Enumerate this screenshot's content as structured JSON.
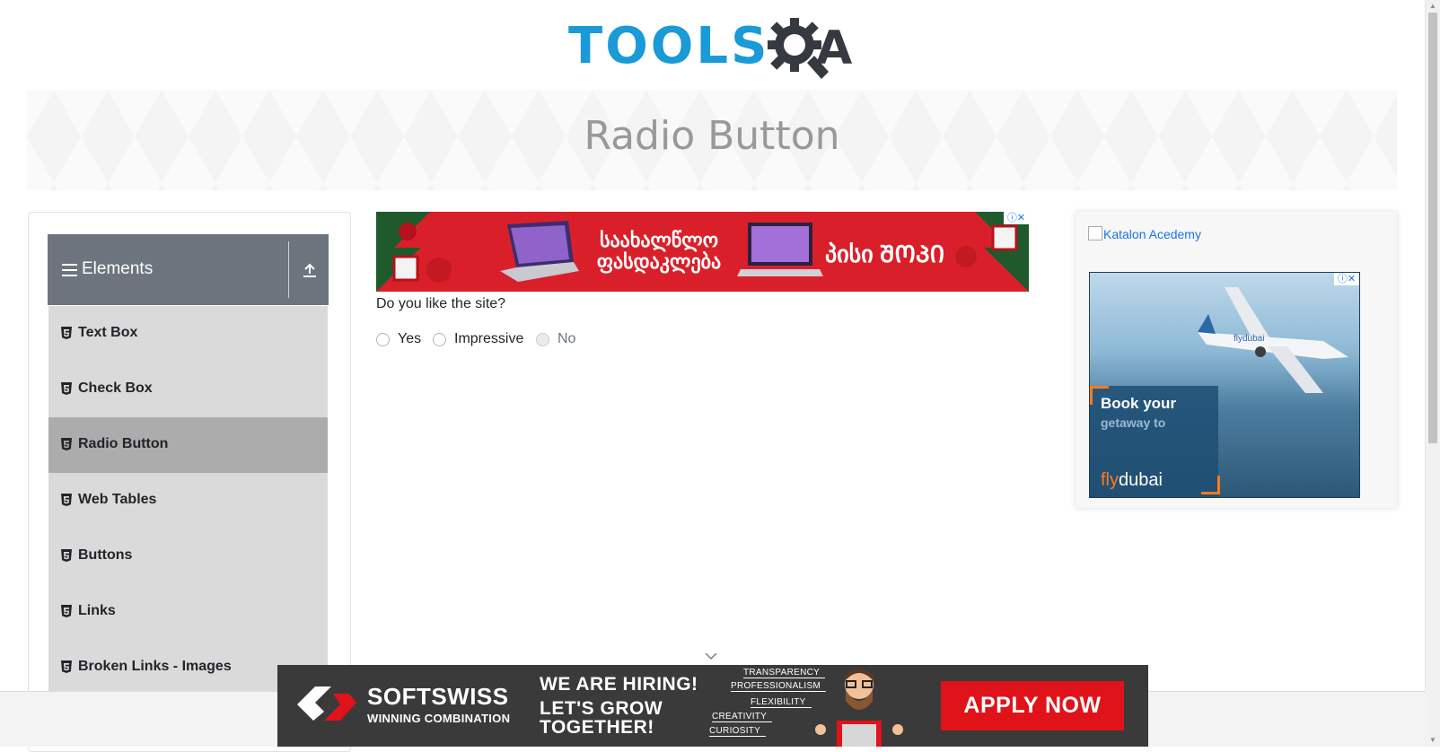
{
  "logo": {
    "text_tools": "TOOLS",
    "text_qa_letter": "A",
    "alt": "ToolsQA"
  },
  "page": {
    "title": "Radio Button"
  },
  "sidebar": {
    "group_title": "Elements",
    "items": [
      {
        "label": "Text Box",
        "active": false
      },
      {
        "label": "Check Box",
        "active": false
      },
      {
        "label": "Radio Button",
        "active": true
      },
      {
        "label": "Web Tables",
        "active": false
      },
      {
        "label": "Buttons",
        "active": false
      },
      {
        "label": "Links",
        "active": false
      },
      {
        "label": "Broken Links - Images",
        "active": false
      }
    ]
  },
  "main": {
    "question": "Do you like the site?",
    "options": [
      {
        "label": "Yes",
        "disabled": false,
        "checked": false
      },
      {
        "label": "Impressive",
        "disabled": false,
        "checked": false
      },
      {
        "label": "No",
        "disabled": true,
        "checked": false
      }
    ]
  },
  "center_ad": {
    "line1": "საახალწლო",
    "line2": "ფასდაკლება",
    "right_text": "პისი ᲨᲝᲞᲘ"
  },
  "right_ad": {
    "broken_image_alt": "Katalon Acedemy",
    "flydubai": {
      "headline": "Book your",
      "subline": "getaway to",
      "brand_fly": "fly",
      "brand_dubai": "dubai"
    }
  },
  "bottom_ad": {
    "brand": "SOFTSWISS",
    "tagline": "WINNING COMBINATION",
    "hiring": "WE ARE HIRING!",
    "grow_line1": "LET'S GROW",
    "grow_line2": "TOGETHER!",
    "values": [
      "TRANSPARENCY",
      "PROFESSIONALISM",
      "FLEXIBILITY",
      "CREATIVITY",
      "CURIOSITY"
    ],
    "cta": "APPLY NOW"
  },
  "colors": {
    "accent_blue": "#1a9ad6",
    "sidebar_header": "#6c757d",
    "menu_bg": "#dadada",
    "menu_active": "#acacac",
    "apply_red": "#e0121a"
  },
  "icons": {
    "menu": "hamburger-icon",
    "collapse": "collapse-up-icon",
    "item": "html5-badge-icon",
    "adchoices": "ad-choices-icon",
    "close": "close-icon",
    "chevron": "chevron-down-icon"
  }
}
